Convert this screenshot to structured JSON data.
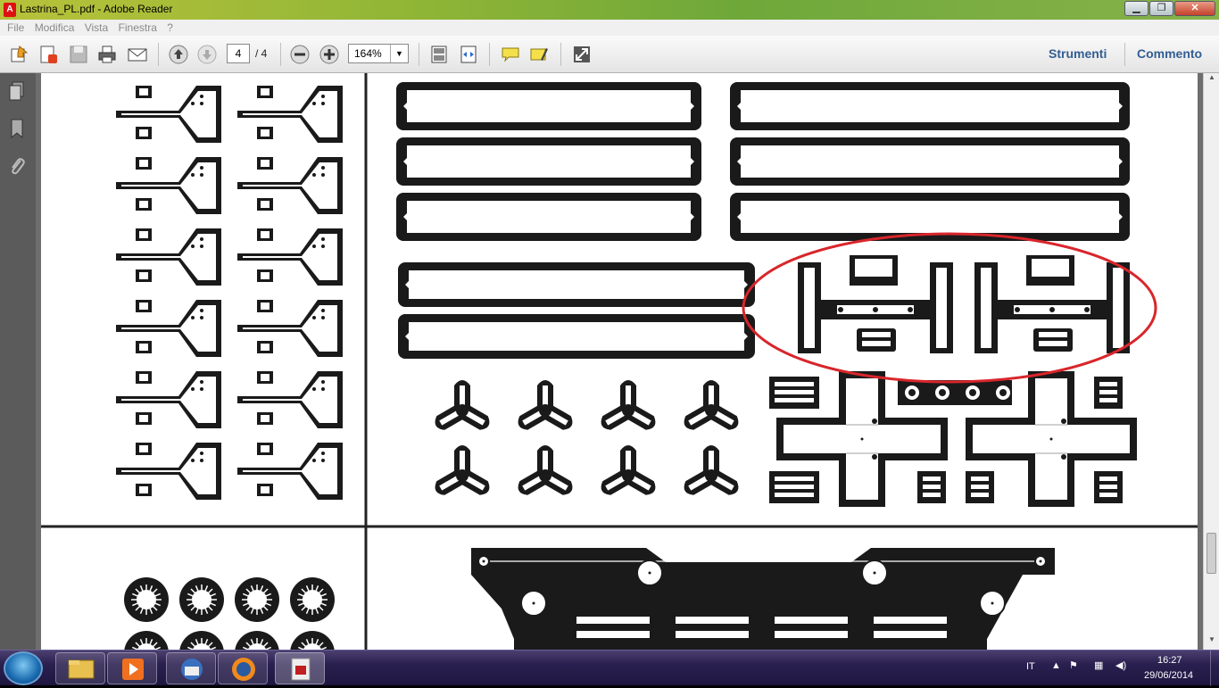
{
  "window": {
    "title": "Lastrina_PL.pdf - Adobe Reader",
    "app_icon": "pdf-icon",
    "minimize_icon": "minimize-icon",
    "maximize_icon": "maximize-icon",
    "close_icon": "close-icon"
  },
  "menu": {
    "items": [
      "File",
      "Modifica",
      "Vista",
      "Finestra",
      "?"
    ]
  },
  "toolbar": {
    "current_page": "4",
    "page_total": "/ 4",
    "zoom": "164%",
    "tools_label": "Strumenti",
    "comment_label": "Commento"
  },
  "sidebar": {
    "icons": [
      "pages-icon",
      "bookmarks-icon",
      "attachments-icon"
    ]
  },
  "taskbar": {
    "language": "IT",
    "time": "16:27",
    "date": "29/06/2014",
    "apps": [
      "explorer-icon",
      "media-player-icon",
      "thunderbird-icon",
      "firefox-icon",
      "adobe-reader-icon"
    ]
  },
  "colors": {
    "annotation_circle": "#d8262b",
    "title_accent": "#8fb536",
    "link_blue": "#335d92"
  }
}
